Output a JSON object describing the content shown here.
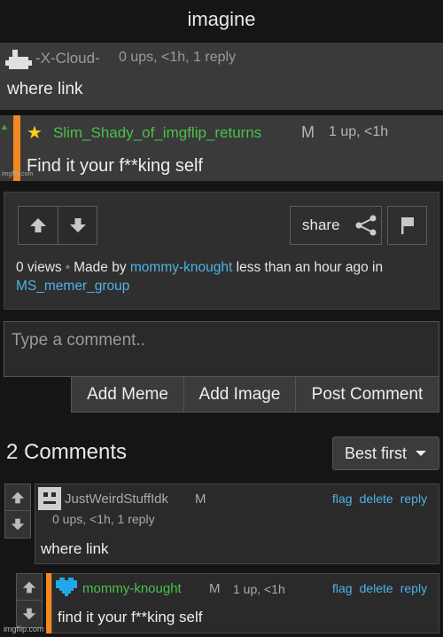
{
  "caption": "imagine",
  "meme": {
    "first_comment": {
      "username": "-X-Cloud-",
      "meta": "0 ups, <1h, 1 reply",
      "text": "where link"
    },
    "second_comment": {
      "username": "Slim_Shady_of_imgflip_returns",
      "mod_badge": "M",
      "meta": "1 up, <1h",
      "text": "Find it your f**king self"
    },
    "watermark": "imgflip.com"
  },
  "panel": {
    "share_label": "share",
    "views": "0 views",
    "made_by_prefix": "Made by",
    "author": "mommy-knought",
    "time_text": "less than an hour ago in",
    "group": "MS_memer_group"
  },
  "comment_box": {
    "placeholder": "Type a comment..",
    "buttons": [
      "Add Meme",
      "Add Image",
      "Post Comment"
    ]
  },
  "comments_header": {
    "count_label": "2 Comments",
    "sort_label": "Best first"
  },
  "comments": [
    {
      "username": "JustWeirdStuffIdk",
      "mod_badge": "M",
      "meta": "0 ups, <1h, 1 reply",
      "text": "where link",
      "actions": [
        "flag",
        "delete",
        "reply"
      ]
    },
    {
      "username": "mommy-knought",
      "mod_badge": "M",
      "meta": "1 up, <1h",
      "text": "find it your f**king self",
      "actions": [
        "flag",
        "delete",
        "reply"
      ]
    }
  ],
  "watermark": "imgflip.com",
  "colors": {
    "link": "#4fb2e8",
    "green_user": "#49c149",
    "orange_bar": "#f5871f",
    "background": "#151515"
  }
}
